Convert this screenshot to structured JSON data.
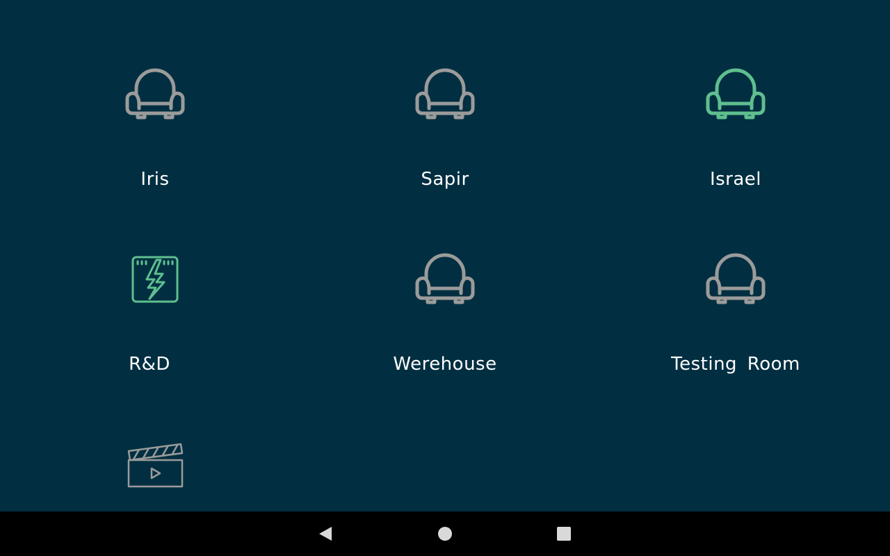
{
  "colors": {
    "background": "#012f41",
    "icon_inactive": "#9b9b9b",
    "icon_active": "#5fbf8f",
    "label": "#ffffff",
    "navbar": "#000000",
    "nav_icon": "#d9d9d9"
  },
  "rooms": [
    {
      "label": "Iris",
      "icon": "armchair-icon",
      "active": false
    },
    {
      "label": "Sapir",
      "icon": "armchair-icon",
      "active": false
    },
    {
      "label": "Israel",
      "icon": "armchair-icon",
      "active": true
    },
    {
      "label": "R&D",
      "icon": "power-panel-icon",
      "active": true
    },
    {
      "label": "Werehouse",
      "icon": "armchair-icon",
      "active": false
    },
    {
      "label": "Testing Room",
      "icon": "armchair-icon",
      "active": false
    },
    {
      "label": "",
      "icon": "clapperboard-icon",
      "active": false
    }
  ],
  "navbar": {
    "back": "back-triangle-icon",
    "home": "home-circle-icon",
    "recent": "recents-square-icon"
  }
}
